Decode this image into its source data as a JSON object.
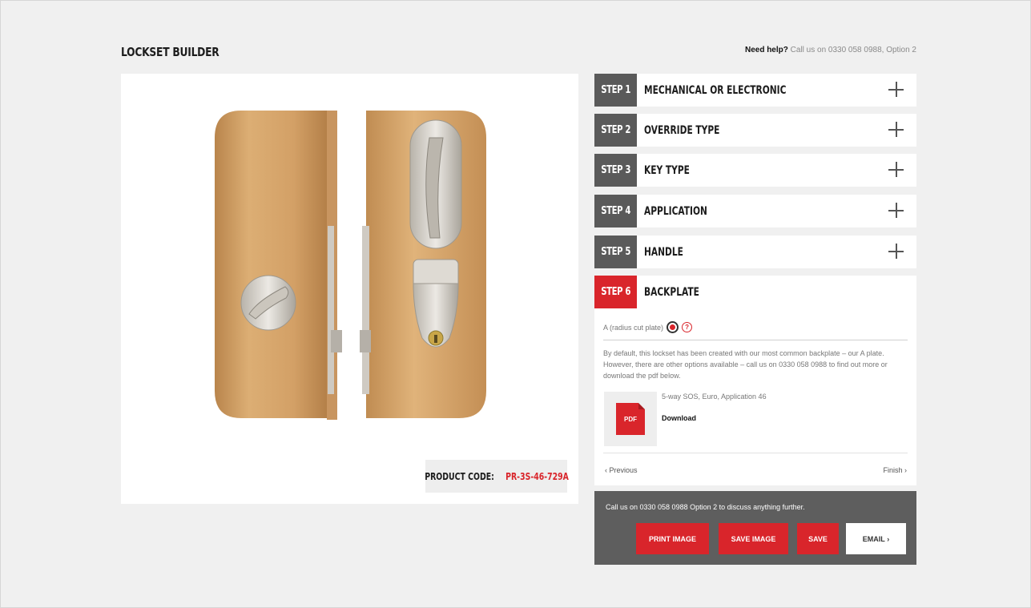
{
  "page": {
    "title": "LOCKSET BUILDER",
    "help_bold": "Need help?",
    "help_text": "Call us on 0330 058 0988, Option 2"
  },
  "preview": {
    "product_code_label": "PRODUCT CODE:",
    "product_code_value": "PR-3S-46-729A"
  },
  "steps": [
    {
      "number": "STEP 1",
      "title": "MECHANICAL OR ELECTRONIC"
    },
    {
      "number": "STEP 2",
      "title": "OVERRIDE TYPE"
    },
    {
      "number": "STEP 3",
      "title": "KEY TYPE"
    },
    {
      "number": "STEP 4",
      "title": "APPLICATION"
    },
    {
      "number": "STEP 5",
      "title": "HANDLE"
    }
  ],
  "active_step": {
    "number": "STEP 6",
    "title": "BACKPLATE",
    "option_label": "A (radius cut plate)",
    "help_glyph": "?",
    "description": "By default, this lockset has been created with our most common backplate – our A plate. However, there are other options available – call us on 0330 058 0988 to find out more or download the pdf below.",
    "pdf_icon_text": "PDF",
    "pdf_name": "5-way SOS, Euro, Application 46",
    "pdf_download": "Download",
    "prev_label": "Previous",
    "next_label": "Finish"
  },
  "actions": {
    "text": "Call us on 0330 058 0988 Option 2 to discuss anything further.",
    "print_image": "PRINT IMAGE",
    "save_image": "SAVE IMAGE",
    "save": "SAVE",
    "email": "EMAIL"
  },
  "icons": {
    "expand": "plus-icon",
    "prev": "chevron-left-icon",
    "next": "chevron-right-icon",
    "pdf": "pdf-file-icon",
    "help": "question-circle-icon"
  },
  "colors": {
    "accent": "#d9252b",
    "step_inactive": "#5a5a5a",
    "action_bar": "#5e5e5e",
    "background": "#f0f0f0"
  }
}
